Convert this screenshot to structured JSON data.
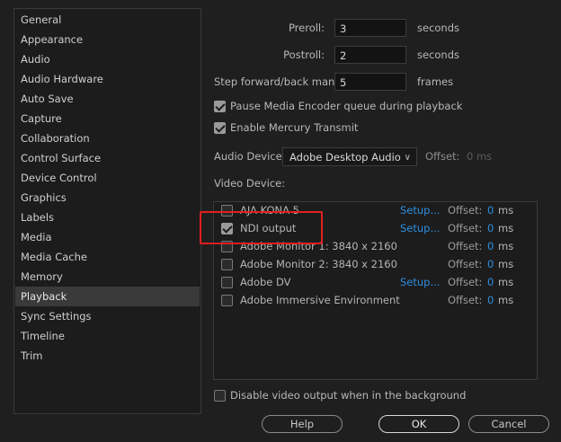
{
  "sidebar": {
    "items": [
      {
        "label": "General"
      },
      {
        "label": "Appearance"
      },
      {
        "label": "Audio"
      },
      {
        "label": "Audio Hardware"
      },
      {
        "label": "Auto Save"
      },
      {
        "label": "Capture"
      },
      {
        "label": "Collaboration"
      },
      {
        "label": "Control Surface"
      },
      {
        "label": "Device Control"
      },
      {
        "label": "Graphics"
      },
      {
        "label": "Labels"
      },
      {
        "label": "Media"
      },
      {
        "label": "Media Cache"
      },
      {
        "label": "Memory"
      },
      {
        "label": "Playback"
      },
      {
        "label": "Sync Settings"
      },
      {
        "label": "Timeline"
      },
      {
        "label": "Trim"
      }
    ],
    "selected": "Playback"
  },
  "playback": {
    "preroll_label": "Preroll:",
    "preroll_value": "3",
    "preroll_unit": "seconds",
    "postroll_label": "Postroll:",
    "postroll_value": "2",
    "postroll_unit": "seconds",
    "step_label": "Step forward/back many:",
    "step_value": "5",
    "step_unit": "frames",
    "pause_media_encoder_label": "Pause Media Encoder queue during playback",
    "pause_media_encoder_checked": true,
    "mercury_label": "Enable Mercury Transmit",
    "mercury_checked": true,
    "audio_device_label": "Audio Device:",
    "audio_device_value": "Adobe Desktop Audio",
    "audio_offset_label": "Offset:",
    "audio_offset_value": "0 ms",
    "video_device_label": "Video Device:"
  },
  "video_devices": [
    {
      "name": "AJA KONA 5",
      "checked": false,
      "setup": "Setup...",
      "offset_label": "Offset:",
      "offset": "0",
      "unit": "ms"
    },
    {
      "name": "NDI output",
      "checked": true,
      "setup": "Setup...",
      "offset_label": "Offset:",
      "offset": "0",
      "unit": "ms"
    },
    {
      "name": "Adobe Monitor 1: 3840 x 2160",
      "checked": false,
      "setup": "",
      "offset_label": "Offset:",
      "offset": "0",
      "unit": "ms"
    },
    {
      "name": "Adobe Monitor 2: 3840 x 2160",
      "checked": false,
      "setup": "",
      "offset_label": "Offset:",
      "offset": "0",
      "unit": "ms"
    },
    {
      "name": "Adobe DV",
      "checked": false,
      "setup": "Setup...",
      "offset_label": "Offset:",
      "offset": "0",
      "unit": "ms"
    },
    {
      "name": "Adobe Immersive Environment",
      "checked": false,
      "setup": "",
      "offset_label": "Offset:",
      "offset": "0",
      "unit": "ms"
    }
  ],
  "disable_video_output_label": "Disable video output when in the background",
  "disable_video_output_checked": false,
  "buttons": {
    "help": "Help",
    "ok": "OK",
    "cancel": "Cancel"
  },
  "colors": {
    "accent_link": "#2f8fe0",
    "highlight_box": "#e21f1f",
    "background": "#1f1f1f"
  },
  "icons": {
    "dropdown": "chevron-down-icon",
    "checkbox": "checkbox-icon"
  }
}
